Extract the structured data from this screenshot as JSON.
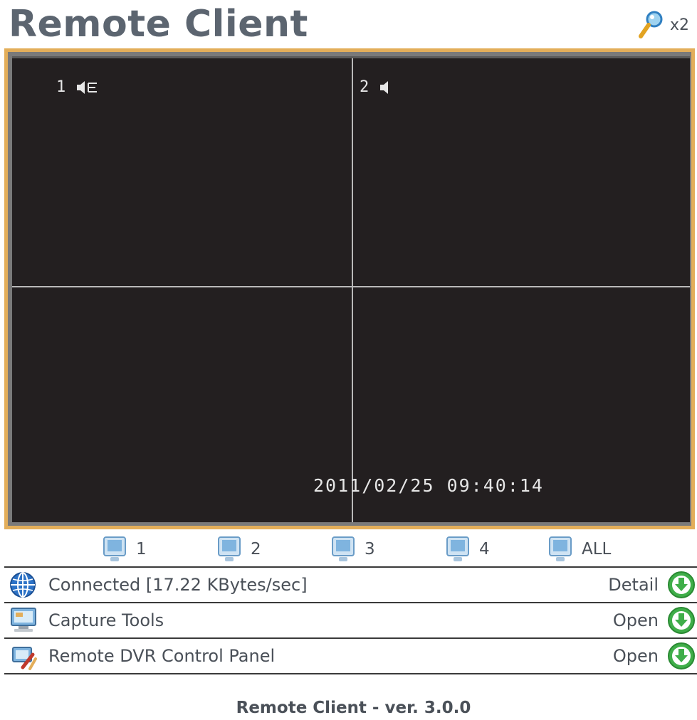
{
  "header": {
    "title": "Remote Client",
    "zoom_label": "x2"
  },
  "viewer": {
    "channel_1_label": "1",
    "channel_2_label": "2",
    "timestamp": "2011/02/25 09:40:14"
  },
  "channel_buttons": [
    {
      "label": "1"
    },
    {
      "label": "2"
    },
    {
      "label": "3"
    },
    {
      "label": "4"
    },
    {
      "label": "ALL"
    }
  ],
  "panels": [
    {
      "label": "Connected [17.22 KBytes/sec]",
      "action": "Detail",
      "icon": "globe-icon"
    },
    {
      "label": "Capture Tools",
      "action": "Open",
      "icon": "monitor-icon"
    },
    {
      "label": "Remote DVR Control Panel",
      "action": "Open",
      "icon": "tools-icon"
    }
  ],
  "footer": {
    "version_text": "Remote Client - ver. 3.0.0"
  },
  "colors": {
    "frame_border": "#e3ae5a",
    "video_bg": "#231f20",
    "text": "#4a5058",
    "action_green": "#3fae49"
  }
}
